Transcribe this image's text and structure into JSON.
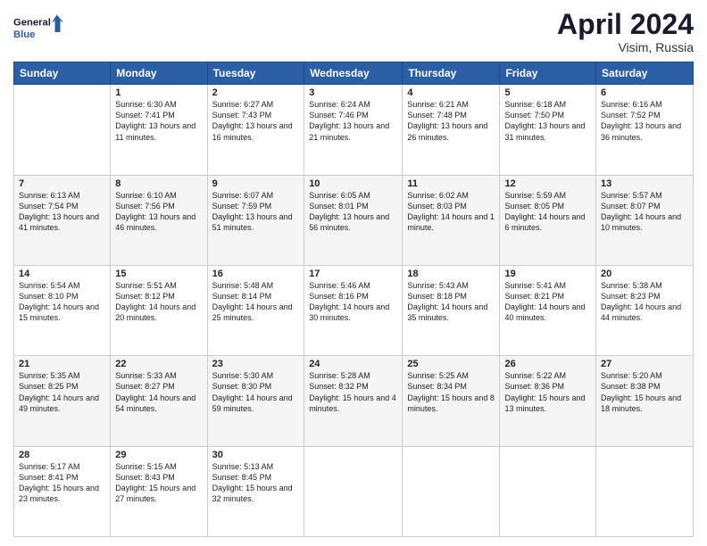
{
  "header": {
    "logo_line1": "General",
    "logo_line2": "Blue",
    "month_title": "April 2024",
    "location": "Visim, Russia"
  },
  "days_of_week": [
    "Sunday",
    "Monday",
    "Tuesday",
    "Wednesday",
    "Thursday",
    "Friday",
    "Saturday"
  ],
  "weeks": [
    [
      {
        "day": "",
        "sunrise": "",
        "sunset": "",
        "daylight": ""
      },
      {
        "day": "1",
        "sunrise": "Sunrise: 6:30 AM",
        "sunset": "Sunset: 7:41 PM",
        "daylight": "Daylight: 13 hours and 11 minutes."
      },
      {
        "day": "2",
        "sunrise": "Sunrise: 6:27 AM",
        "sunset": "Sunset: 7:43 PM",
        "daylight": "Daylight: 13 hours and 16 minutes."
      },
      {
        "day": "3",
        "sunrise": "Sunrise: 6:24 AM",
        "sunset": "Sunset: 7:46 PM",
        "daylight": "Daylight: 13 hours and 21 minutes."
      },
      {
        "day": "4",
        "sunrise": "Sunrise: 6:21 AM",
        "sunset": "Sunset: 7:48 PM",
        "daylight": "Daylight: 13 hours and 26 minutes."
      },
      {
        "day": "5",
        "sunrise": "Sunrise: 6:18 AM",
        "sunset": "Sunset: 7:50 PM",
        "daylight": "Daylight: 13 hours and 31 minutes."
      },
      {
        "day": "6",
        "sunrise": "Sunrise: 6:16 AM",
        "sunset": "Sunset: 7:52 PM",
        "daylight": "Daylight: 13 hours and 36 minutes."
      }
    ],
    [
      {
        "day": "7",
        "sunrise": "Sunrise: 6:13 AM",
        "sunset": "Sunset: 7:54 PM",
        "daylight": "Daylight: 13 hours and 41 minutes."
      },
      {
        "day": "8",
        "sunrise": "Sunrise: 6:10 AM",
        "sunset": "Sunset: 7:56 PM",
        "daylight": "Daylight: 13 hours and 46 minutes."
      },
      {
        "day": "9",
        "sunrise": "Sunrise: 6:07 AM",
        "sunset": "Sunset: 7:59 PM",
        "daylight": "Daylight: 13 hours and 51 minutes."
      },
      {
        "day": "10",
        "sunrise": "Sunrise: 6:05 AM",
        "sunset": "Sunset: 8:01 PM",
        "daylight": "Daylight: 13 hours and 56 minutes."
      },
      {
        "day": "11",
        "sunrise": "Sunrise: 6:02 AM",
        "sunset": "Sunset: 8:03 PM",
        "daylight": "Daylight: 14 hours and 1 minute."
      },
      {
        "day": "12",
        "sunrise": "Sunrise: 5:59 AM",
        "sunset": "Sunset: 8:05 PM",
        "daylight": "Daylight: 14 hours and 6 minutes."
      },
      {
        "day": "13",
        "sunrise": "Sunrise: 5:57 AM",
        "sunset": "Sunset: 8:07 PM",
        "daylight": "Daylight: 14 hours and 10 minutes."
      }
    ],
    [
      {
        "day": "14",
        "sunrise": "Sunrise: 5:54 AM",
        "sunset": "Sunset: 8:10 PM",
        "daylight": "Daylight: 14 hours and 15 minutes."
      },
      {
        "day": "15",
        "sunrise": "Sunrise: 5:51 AM",
        "sunset": "Sunset: 8:12 PM",
        "daylight": "Daylight: 14 hours and 20 minutes."
      },
      {
        "day": "16",
        "sunrise": "Sunrise: 5:48 AM",
        "sunset": "Sunset: 8:14 PM",
        "daylight": "Daylight: 14 hours and 25 minutes."
      },
      {
        "day": "17",
        "sunrise": "Sunrise: 5:46 AM",
        "sunset": "Sunset: 8:16 PM",
        "daylight": "Daylight: 14 hours and 30 minutes."
      },
      {
        "day": "18",
        "sunrise": "Sunrise: 5:43 AM",
        "sunset": "Sunset: 8:18 PM",
        "daylight": "Daylight: 14 hours and 35 minutes."
      },
      {
        "day": "19",
        "sunrise": "Sunrise: 5:41 AM",
        "sunset": "Sunset: 8:21 PM",
        "daylight": "Daylight: 14 hours and 40 minutes."
      },
      {
        "day": "20",
        "sunrise": "Sunrise: 5:38 AM",
        "sunset": "Sunset: 8:23 PM",
        "daylight": "Daylight: 14 hours and 44 minutes."
      }
    ],
    [
      {
        "day": "21",
        "sunrise": "Sunrise: 5:35 AM",
        "sunset": "Sunset: 8:25 PM",
        "daylight": "Daylight: 14 hours and 49 minutes."
      },
      {
        "day": "22",
        "sunrise": "Sunrise: 5:33 AM",
        "sunset": "Sunset: 8:27 PM",
        "daylight": "Daylight: 14 hours and 54 minutes."
      },
      {
        "day": "23",
        "sunrise": "Sunrise: 5:30 AM",
        "sunset": "Sunset: 8:30 PM",
        "daylight": "Daylight: 14 hours and 59 minutes."
      },
      {
        "day": "24",
        "sunrise": "Sunrise: 5:28 AM",
        "sunset": "Sunset: 8:32 PM",
        "daylight": "Daylight: 15 hours and 4 minutes."
      },
      {
        "day": "25",
        "sunrise": "Sunrise: 5:25 AM",
        "sunset": "Sunset: 8:34 PM",
        "daylight": "Daylight: 15 hours and 8 minutes."
      },
      {
        "day": "26",
        "sunrise": "Sunrise: 5:22 AM",
        "sunset": "Sunset: 8:36 PM",
        "daylight": "Daylight: 15 hours and 13 minutes."
      },
      {
        "day": "27",
        "sunrise": "Sunrise: 5:20 AM",
        "sunset": "Sunset: 8:38 PM",
        "daylight": "Daylight: 15 hours and 18 minutes."
      }
    ],
    [
      {
        "day": "28",
        "sunrise": "Sunrise: 5:17 AM",
        "sunset": "Sunset: 8:41 PM",
        "daylight": "Daylight: 15 hours and 23 minutes."
      },
      {
        "day": "29",
        "sunrise": "Sunrise: 5:15 AM",
        "sunset": "Sunset: 8:43 PM",
        "daylight": "Daylight: 15 hours and 27 minutes."
      },
      {
        "day": "30",
        "sunrise": "Sunrise: 5:13 AM",
        "sunset": "Sunset: 8:45 PM",
        "daylight": "Daylight: 15 hours and 32 minutes."
      },
      {
        "day": "",
        "sunrise": "",
        "sunset": "",
        "daylight": ""
      },
      {
        "day": "",
        "sunrise": "",
        "sunset": "",
        "daylight": ""
      },
      {
        "day": "",
        "sunrise": "",
        "sunset": "",
        "daylight": ""
      },
      {
        "day": "",
        "sunrise": "",
        "sunset": "",
        "daylight": ""
      }
    ]
  ]
}
